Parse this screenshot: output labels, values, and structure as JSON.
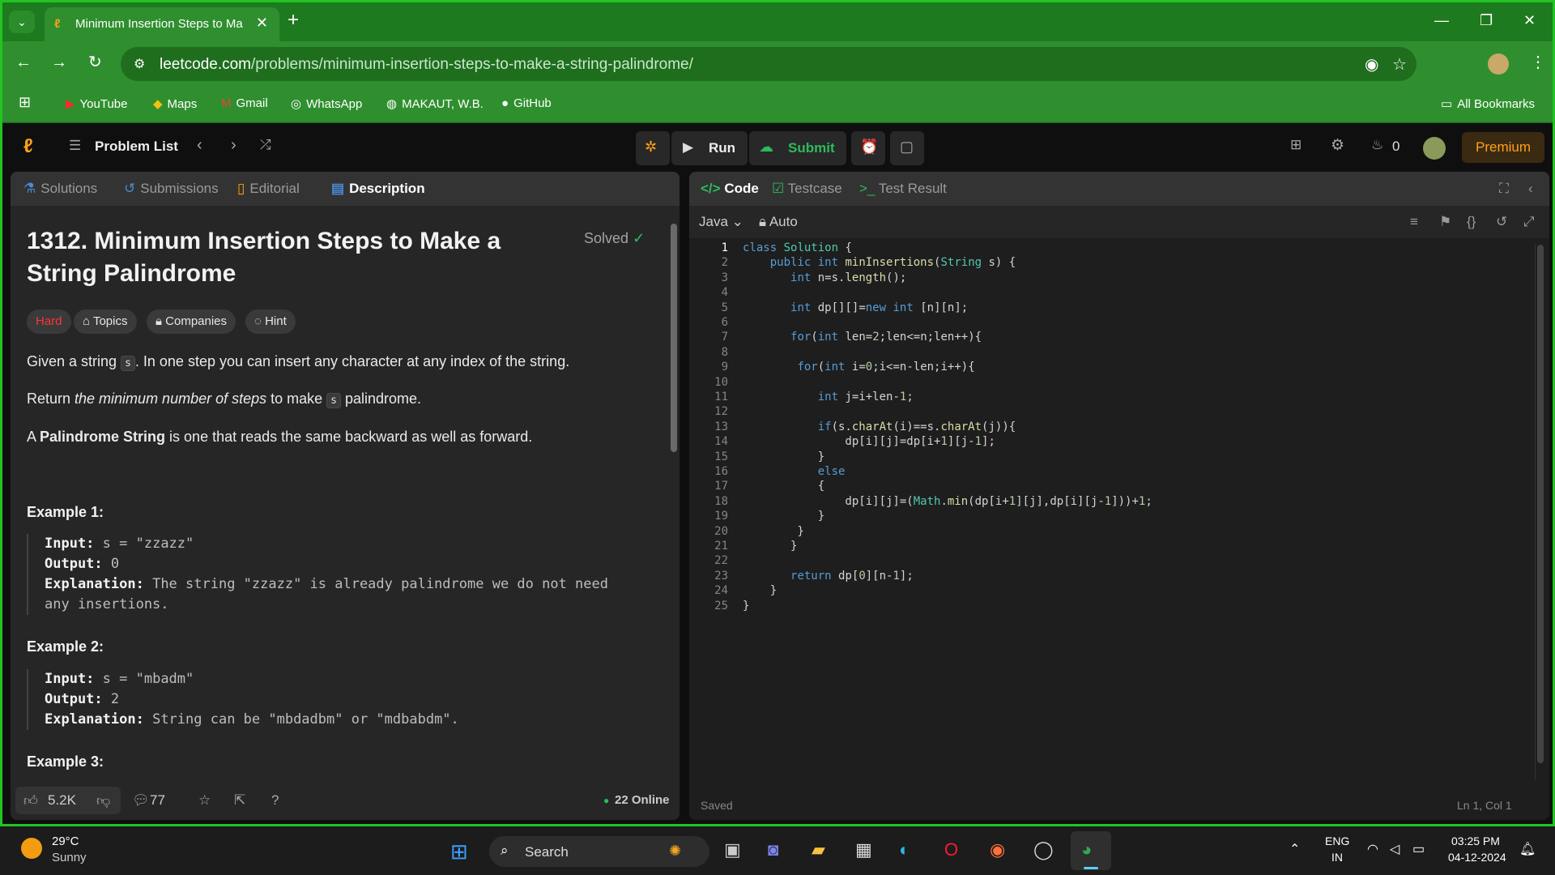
{
  "browser": {
    "tab_title": "Minimum Insertion Steps to Ma",
    "url_domain": "leetcode.com",
    "url_path": "/problems/minimum-insertion-steps-to-make-a-string-palindrome/",
    "bookmarks": [
      "YouTube",
      "Maps",
      "Gmail",
      "WhatsApp",
      "MAKAUT, W.B.",
      "GitHub"
    ],
    "all_bookmarks": "All Bookmarks"
  },
  "header": {
    "problem_list": "Problem List",
    "run": "Run",
    "submit": "Submit",
    "streak": "0",
    "premium": "Premium"
  },
  "left": {
    "tabs": [
      "Solutions",
      "Submissions",
      "Editorial",
      "Description"
    ],
    "title": "1312. Minimum Insertion Steps to Make a String Palindrome",
    "solved": "Solved",
    "chips": [
      "Hard",
      "Topics",
      "Companies",
      "Hint"
    ],
    "p1_a": "Given a string ",
    "p1_code": "s",
    "p1_b": ". In one step you can insert any character at any index of the string.",
    "p2_a": "Return ",
    "p2_em": "the minimum number of steps",
    "p2_b": " to make ",
    "p2_code": "s",
    "p2_c": " palindrome.",
    "p3_a": "A ",
    "p3_b": "Palindrome String",
    "p3_c": " is one that reads the same backward as well as forward.",
    "ex1_h": "Example 1:",
    "ex1_in": "s = \"zzazz\"",
    "ex1_out": "0",
    "ex1_exp": "The string \"zzazz\" is already palindrome we do not need any insertions.",
    "ex2_h": "Example 2:",
    "ex2_in": "s = \"mbadm\"",
    "ex2_out": "2",
    "ex2_exp": "String can be \"mbdadbm\" or \"mdbabdm\".",
    "ex3_h": "Example 3:",
    "lbl_input": "Input:",
    "lbl_output": "Output:",
    "lbl_exp": "Explanation:",
    "likes": "5.2K",
    "comments": "77",
    "online": "22 Online"
  },
  "right": {
    "tabs": [
      "Code",
      "Testcase",
      "Test Result"
    ],
    "language": "Java",
    "auto": "Auto",
    "status": "Saved",
    "cursor": "Ln 1, Col 1"
  },
  "taskbar": {
    "temp": "29°C",
    "weather": "Sunny",
    "search": "Search",
    "lang1": "ENG",
    "lang2": "IN",
    "time": "03:25 PM",
    "date": "04-12-2024"
  }
}
